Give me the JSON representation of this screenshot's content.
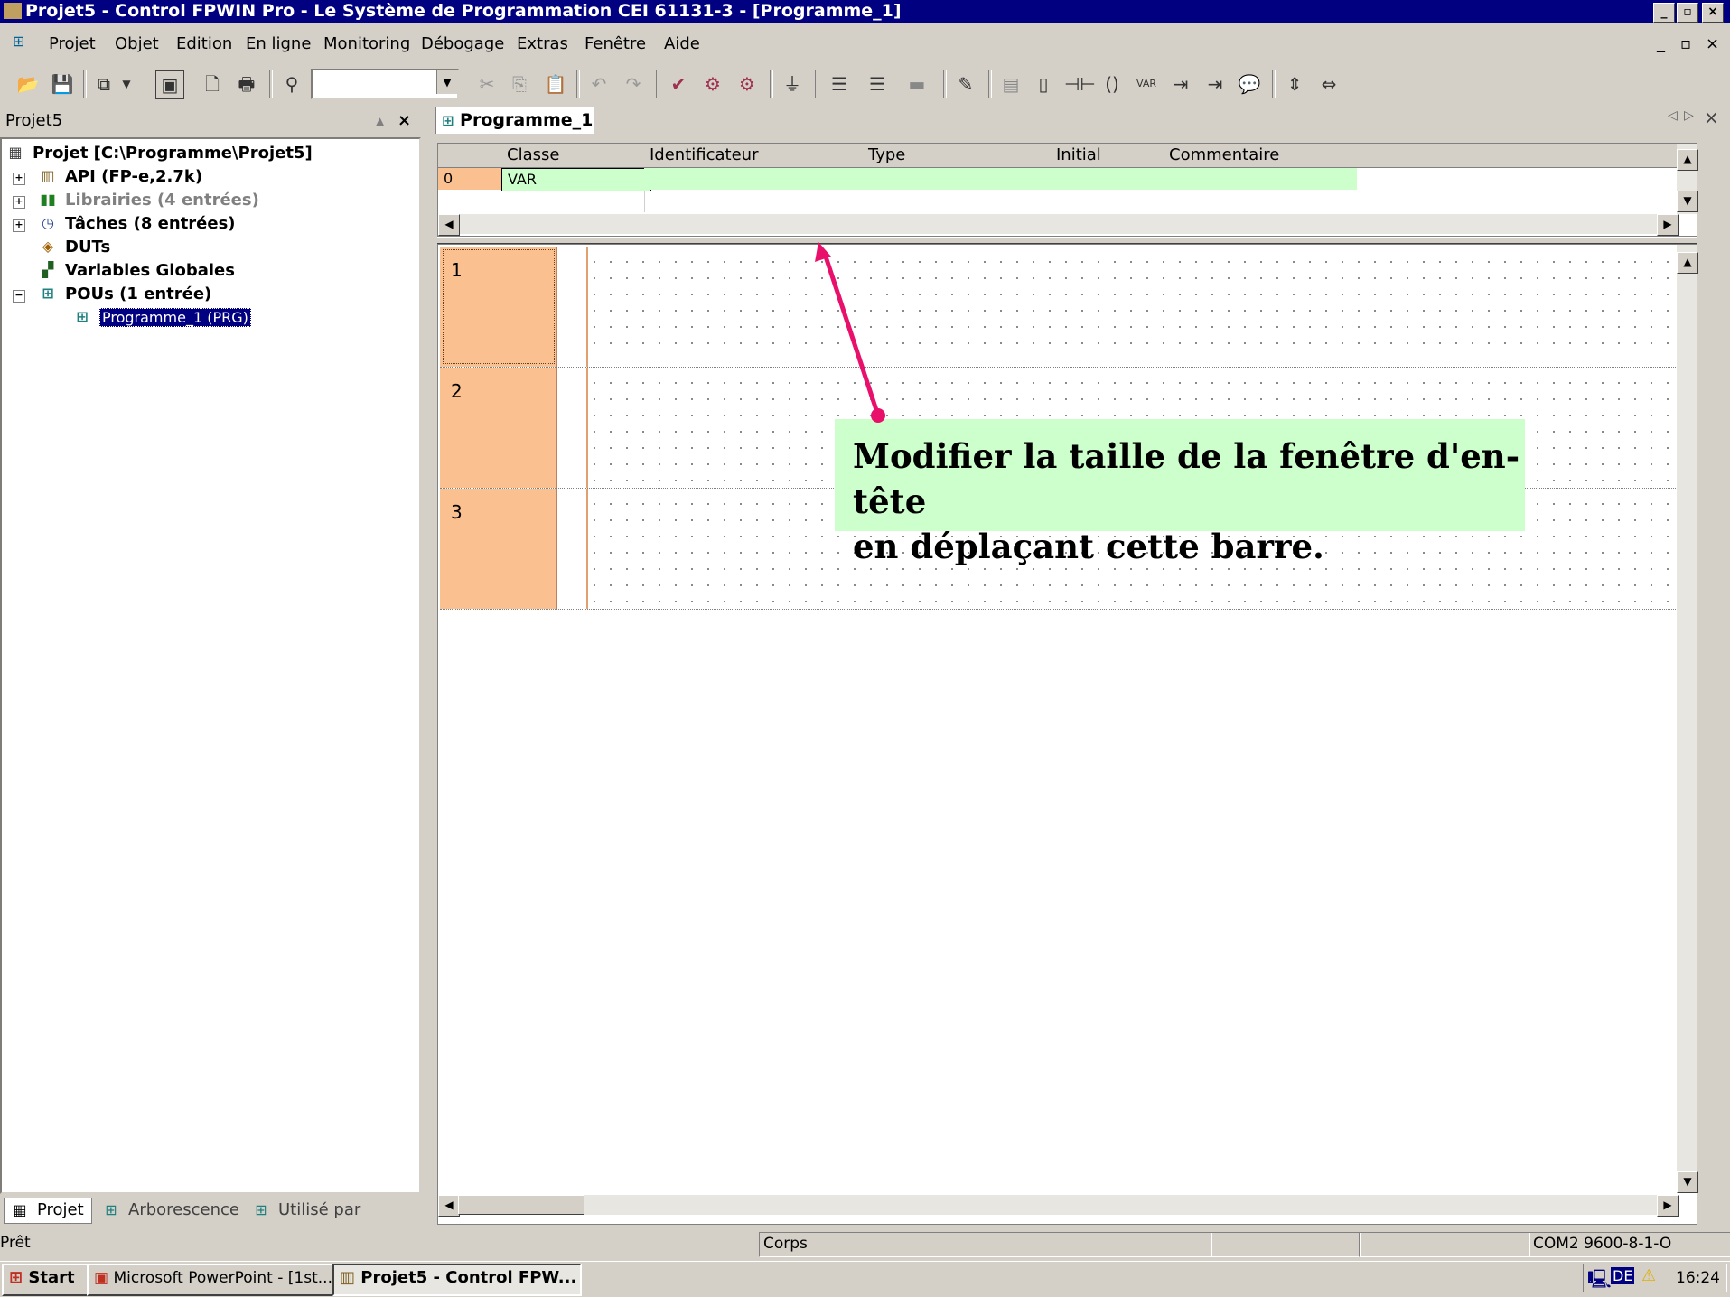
{
  "window": {
    "title": "Projet5 - Control FPWIN Pro - Le Système de Programmation CEI 61131-3 - [Programme_1]",
    "caption_buttons": [
      "_",
      "▫",
      "×"
    ]
  },
  "menu": {
    "items": [
      "Projet",
      "Objet",
      "Edition",
      "En ligne",
      "Monitoring",
      "Débogage",
      "Extras",
      "Fenêtre",
      "Aide"
    ],
    "mdi_buttons": [
      "_",
      "▫",
      "×"
    ]
  },
  "toolbar": {
    "search_value": ""
  },
  "project_panel": {
    "title": "Projet5",
    "tree": [
      {
        "label": "Projet [C:\\Programme\\Projet5]",
        "icon": "project-icon"
      },
      {
        "label": "API (FP-e,2.7k)",
        "icon": "plc-icon"
      },
      {
        "label": "Librairies (4 entrées)",
        "icon": "library-icon"
      },
      {
        "label": "Tâches (8 entrées)",
        "icon": "task-icon"
      },
      {
        "label": "DUTs",
        "icon": "dut-icon"
      },
      {
        "label": "Variables Globales",
        "icon": "global-vars-icon"
      },
      {
        "label": "POUs (1 entrée)",
        "icon": "pou-icon"
      },
      {
        "label": "Programme_1 (PRG)",
        "icon": "program-icon"
      }
    ],
    "tabs": [
      "Projet",
      "Arborescence",
      "Utilisé par"
    ]
  },
  "editor": {
    "tab_label": "Programme_1",
    "header_columns": [
      "Classe",
      "Identificateur",
      "Type",
      "Initial",
      "Commentaire"
    ],
    "header_rows": [
      {
        "index": "0",
        "classe": "VAR",
        "identificateur": "",
        "type": "",
        "initial": "",
        "commentaire": ""
      }
    ],
    "networks": [
      "1",
      "2",
      "3"
    ]
  },
  "annotation": {
    "line1": "Modifier la taille de la fenêtre d'en-tête",
    "line2": "en déplaçant cette barre.",
    "arrow_color": "#e8106a",
    "box_color": "#ccffcc"
  },
  "statusbar": {
    "ready": "Prêt",
    "section": "Corps",
    "com": "COM2 9600-8-1-O"
  },
  "taskbar": {
    "start": "Start",
    "apps": [
      "Microsoft PowerPoint - [1st...",
      "Projet5 - Control FPW..."
    ],
    "language": "DE",
    "clock": "16:24"
  }
}
